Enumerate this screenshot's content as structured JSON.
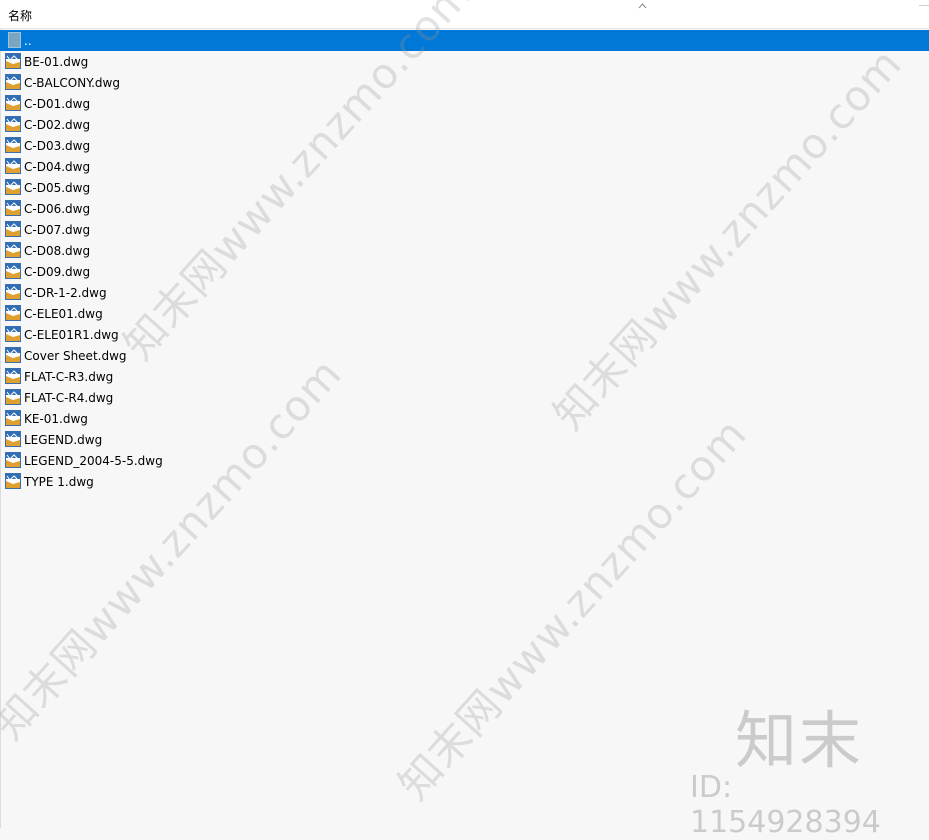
{
  "header": {
    "column_name": "名称",
    "sort_icon": "chevron-up-icon"
  },
  "parent_entry": {
    "label": ".."
  },
  "file_icon": "dwg-file-icon",
  "files": [
    "BE-01.dwg",
    "C-BALCONY.dwg",
    "C-D01.dwg",
    "C-D02.dwg",
    "C-D03.dwg",
    "C-D04.dwg",
    "C-D05.dwg",
    "C-D06.dwg",
    "C-D07.dwg",
    "C-D08.dwg",
    "C-D09.dwg",
    "C-DR-1-2.dwg",
    "C-ELE01.dwg",
    "C-ELE01R1.dwg",
    "Cover Sheet.dwg",
    "FLAT-C-R3.dwg",
    "FLAT-C-R4.dwg",
    "KE-01.dwg",
    "LEGEND.dwg",
    "LEGEND_2004-5-5.dwg",
    "TYPE 1.dwg"
  ],
  "watermark": {
    "text": "知末网www.znzmo.com",
    "logo": "知末",
    "id": "ID: 1154928394"
  },
  "colors": {
    "selection": "#0078d7",
    "background": "#f7f7f7",
    "header_bg": "#ffffff"
  }
}
